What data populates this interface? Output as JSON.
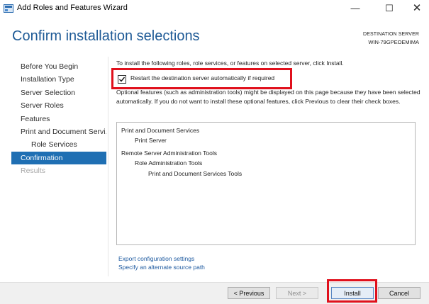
{
  "window": {
    "title": "Add Roles and Features Wizard",
    "controls": {
      "minimize": "—",
      "maximize": "☐",
      "close": "✕"
    }
  },
  "header": {
    "title": "Confirm installation selections",
    "destination_label": "DESTINATION SERVER",
    "destination_server": "WIN-79GPEOEMIMA"
  },
  "nav": {
    "items": [
      {
        "label": "Before You Begin",
        "state": "normal"
      },
      {
        "label": "Installation Type",
        "state": "normal"
      },
      {
        "label": "Server Selection",
        "state": "normal"
      },
      {
        "label": "Server Roles",
        "state": "normal"
      },
      {
        "label": "Features",
        "state": "normal"
      },
      {
        "label": "Print and Document Servi...",
        "state": "normal"
      },
      {
        "label": "Role Services",
        "state": "sub"
      },
      {
        "label": "Confirmation",
        "state": "active"
      },
      {
        "label": "Results",
        "state": "disabled"
      }
    ]
  },
  "content": {
    "intro": "To install the following roles, role services, or features on selected server, click Install.",
    "restart_checkbox": {
      "label": "Restart the destination server automatically if required",
      "checked": true
    },
    "optional_text": "Optional features (such as administration tools) might be displayed on this page because they have been selected automatically. If you do not want to install these optional features, click Previous to clear their check boxes.",
    "features": [
      "Print and Document Services",
      "Print Server",
      "Remote Server Administration Tools",
      "Role Administration Tools",
      "Print and Document Services Tools"
    ],
    "links": {
      "export": "Export configuration settings",
      "alternate_source": "Specify an alternate source path"
    }
  },
  "buttons": {
    "previous": "< Previous",
    "next": "Next >",
    "install": "Install",
    "cancel": "Cancel"
  },
  "colors": {
    "accent": "#1f6fb3",
    "title_blue": "#1e5a96",
    "highlight": "#e0101c",
    "link": "#1e5aa0"
  }
}
